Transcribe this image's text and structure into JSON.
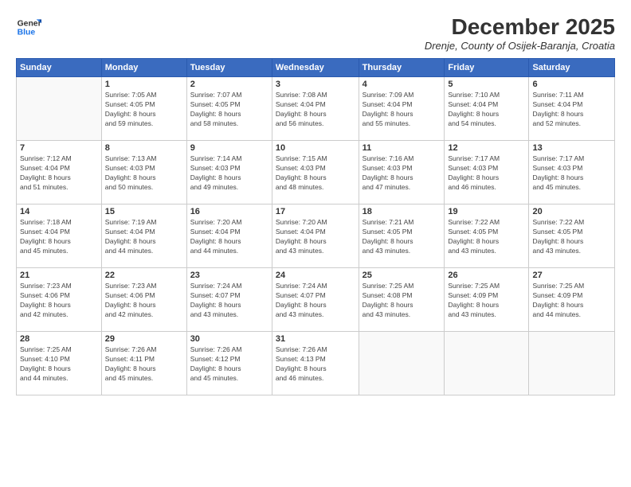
{
  "header": {
    "logo": {
      "line1": "General",
      "line2": "Blue"
    },
    "title": "December 2025",
    "location": "Drenje, County of Osijek-Baranja, Croatia"
  },
  "weekdays": [
    "Sunday",
    "Monday",
    "Tuesday",
    "Wednesday",
    "Thursday",
    "Friday",
    "Saturday"
  ],
  "weeks": [
    [
      {
        "day": "",
        "info": ""
      },
      {
        "day": "1",
        "info": "Sunrise: 7:05 AM\nSunset: 4:05 PM\nDaylight: 8 hours\nand 59 minutes."
      },
      {
        "day": "2",
        "info": "Sunrise: 7:07 AM\nSunset: 4:05 PM\nDaylight: 8 hours\nand 58 minutes."
      },
      {
        "day": "3",
        "info": "Sunrise: 7:08 AM\nSunset: 4:04 PM\nDaylight: 8 hours\nand 56 minutes."
      },
      {
        "day": "4",
        "info": "Sunrise: 7:09 AM\nSunset: 4:04 PM\nDaylight: 8 hours\nand 55 minutes."
      },
      {
        "day": "5",
        "info": "Sunrise: 7:10 AM\nSunset: 4:04 PM\nDaylight: 8 hours\nand 54 minutes."
      },
      {
        "day": "6",
        "info": "Sunrise: 7:11 AM\nSunset: 4:04 PM\nDaylight: 8 hours\nand 52 minutes."
      }
    ],
    [
      {
        "day": "7",
        "info": "Sunrise: 7:12 AM\nSunset: 4:04 PM\nDaylight: 8 hours\nand 51 minutes."
      },
      {
        "day": "8",
        "info": "Sunrise: 7:13 AM\nSunset: 4:03 PM\nDaylight: 8 hours\nand 50 minutes."
      },
      {
        "day": "9",
        "info": "Sunrise: 7:14 AM\nSunset: 4:03 PM\nDaylight: 8 hours\nand 49 minutes."
      },
      {
        "day": "10",
        "info": "Sunrise: 7:15 AM\nSunset: 4:03 PM\nDaylight: 8 hours\nand 48 minutes."
      },
      {
        "day": "11",
        "info": "Sunrise: 7:16 AM\nSunset: 4:03 PM\nDaylight: 8 hours\nand 47 minutes."
      },
      {
        "day": "12",
        "info": "Sunrise: 7:17 AM\nSunset: 4:03 PM\nDaylight: 8 hours\nand 46 minutes."
      },
      {
        "day": "13",
        "info": "Sunrise: 7:17 AM\nSunset: 4:03 PM\nDaylight: 8 hours\nand 45 minutes."
      }
    ],
    [
      {
        "day": "14",
        "info": "Sunrise: 7:18 AM\nSunset: 4:04 PM\nDaylight: 8 hours\nand 45 minutes."
      },
      {
        "day": "15",
        "info": "Sunrise: 7:19 AM\nSunset: 4:04 PM\nDaylight: 8 hours\nand 44 minutes."
      },
      {
        "day": "16",
        "info": "Sunrise: 7:20 AM\nSunset: 4:04 PM\nDaylight: 8 hours\nand 44 minutes."
      },
      {
        "day": "17",
        "info": "Sunrise: 7:20 AM\nSunset: 4:04 PM\nDaylight: 8 hours\nand 43 minutes."
      },
      {
        "day": "18",
        "info": "Sunrise: 7:21 AM\nSunset: 4:05 PM\nDaylight: 8 hours\nand 43 minutes."
      },
      {
        "day": "19",
        "info": "Sunrise: 7:22 AM\nSunset: 4:05 PM\nDaylight: 8 hours\nand 43 minutes."
      },
      {
        "day": "20",
        "info": "Sunrise: 7:22 AM\nSunset: 4:05 PM\nDaylight: 8 hours\nand 43 minutes."
      }
    ],
    [
      {
        "day": "21",
        "info": "Sunrise: 7:23 AM\nSunset: 4:06 PM\nDaylight: 8 hours\nand 42 minutes."
      },
      {
        "day": "22",
        "info": "Sunrise: 7:23 AM\nSunset: 4:06 PM\nDaylight: 8 hours\nand 42 minutes."
      },
      {
        "day": "23",
        "info": "Sunrise: 7:24 AM\nSunset: 4:07 PM\nDaylight: 8 hours\nand 43 minutes."
      },
      {
        "day": "24",
        "info": "Sunrise: 7:24 AM\nSunset: 4:07 PM\nDaylight: 8 hours\nand 43 minutes."
      },
      {
        "day": "25",
        "info": "Sunrise: 7:25 AM\nSunset: 4:08 PM\nDaylight: 8 hours\nand 43 minutes."
      },
      {
        "day": "26",
        "info": "Sunrise: 7:25 AM\nSunset: 4:09 PM\nDaylight: 8 hours\nand 43 minutes."
      },
      {
        "day": "27",
        "info": "Sunrise: 7:25 AM\nSunset: 4:09 PM\nDaylight: 8 hours\nand 44 minutes."
      }
    ],
    [
      {
        "day": "28",
        "info": "Sunrise: 7:25 AM\nSunset: 4:10 PM\nDaylight: 8 hours\nand 44 minutes."
      },
      {
        "day": "29",
        "info": "Sunrise: 7:26 AM\nSunset: 4:11 PM\nDaylight: 8 hours\nand 45 minutes."
      },
      {
        "day": "30",
        "info": "Sunrise: 7:26 AM\nSunset: 4:12 PM\nDaylight: 8 hours\nand 45 minutes."
      },
      {
        "day": "31",
        "info": "Sunrise: 7:26 AM\nSunset: 4:13 PM\nDaylight: 8 hours\nand 46 minutes."
      },
      {
        "day": "",
        "info": ""
      },
      {
        "day": "",
        "info": ""
      },
      {
        "day": "",
        "info": ""
      }
    ]
  ]
}
